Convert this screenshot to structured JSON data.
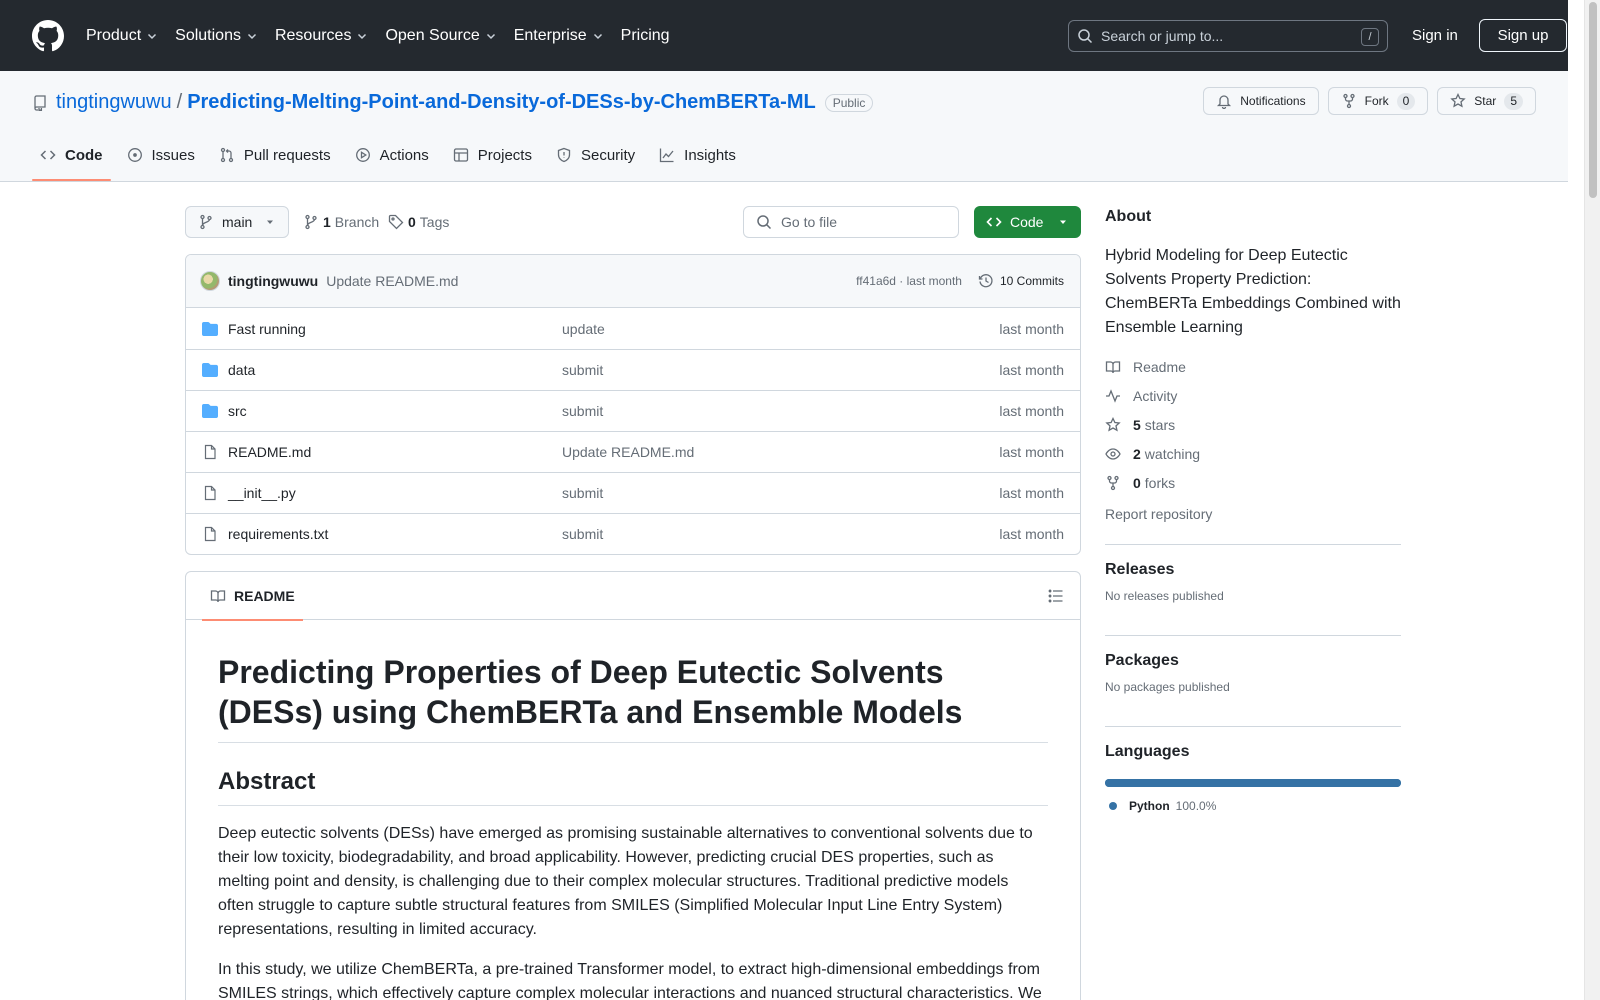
{
  "header": {
    "nav": [
      "Product",
      "Solutions",
      "Resources",
      "Open Source",
      "Enterprise",
      "Pricing"
    ],
    "search_placeholder": "Search or jump to...",
    "search_key": "/",
    "signin": "Sign in",
    "signup": "Sign up"
  },
  "repo": {
    "owner": "tingtingwuwu",
    "separator": "/",
    "name": "Predicting-Melting-Point-and-Density-of-DESs-by-ChemBERTa-ML",
    "visibility": "Public",
    "notifications": "Notifications",
    "fork_label": "Fork",
    "fork_count": "0",
    "star_label": "Star",
    "star_count": "5",
    "tabs": [
      "Code",
      "Issues",
      "Pull requests",
      "Actions",
      "Projects",
      "Security",
      "Insights"
    ]
  },
  "toolbar": {
    "branch": "main",
    "branch_count": "1",
    "branch_label": "Branch",
    "tag_count": "0",
    "tag_label": "Tags",
    "goto_placeholder": "Go to file",
    "code_label": "Code"
  },
  "commit": {
    "author": "tingtingwuwu",
    "message": "Update README.md",
    "hash_time": "ff41a6d · last month",
    "count": "10 Commits"
  },
  "files": [
    {
      "name": "Fast running",
      "type": "dir",
      "message": "update",
      "time": "last month"
    },
    {
      "name": "data",
      "type": "dir",
      "message": "submit",
      "time": "last month"
    },
    {
      "name": "src",
      "type": "dir",
      "message": "submit",
      "time": "last month"
    },
    {
      "name": "README.md",
      "type": "file",
      "message": "Update README.md",
      "time": "last month"
    },
    {
      "name": "__init__.py",
      "type": "file",
      "message": "submit",
      "time": "last month"
    },
    {
      "name": "requirements.txt",
      "type": "file",
      "message": "submit",
      "time": "last month"
    }
  ],
  "readme": {
    "tab_label": "README",
    "title": "Predicting Properties of Deep Eutectic Solvents (DESs) using ChemBERTa and Ensemble Models",
    "abstract_heading": "Abstract",
    "paragraph1": "Deep eutectic solvents (DESs) have emerged as promising sustainable alternatives to conventional solvents due to their low toxicity, biodegradability, and broad applicability. However, predicting crucial DES properties, such as melting point and density, is challenging due to their complex molecular structures. Traditional predictive models often struggle to capture subtle structural features from SMILES (Simplified Molecular Input Line Entry System) representations, resulting in limited accuracy.",
    "paragraph2": "In this study, we utilize ChemBERTa, a pre-trained Transformer model, to extract high-dimensional embeddings from SMILES strings, which effectively capture complex molecular interactions and nuanced structural characteristics. We"
  },
  "sidebar": {
    "about_title": "About",
    "description": "Hybrid Modeling for Deep Eutectic Solvents Property Prediction: ChemBERTa Embeddings Combined with Ensemble Learning",
    "readme": "Readme",
    "activity": "Activity",
    "stars_count": "5",
    "stars_label": "stars",
    "watching_count": "2",
    "watching_label": "watching",
    "forks_count": "0",
    "forks_label": "forks",
    "report": "Report repository",
    "releases_title": "Releases",
    "releases_text": "No releases published",
    "packages_title": "Packages",
    "packages_text": "No packages published",
    "languages_title": "Languages",
    "language_name": "Python",
    "language_pct": "100.0%",
    "language_share": 1.0,
    "language_color": "#3572a5"
  }
}
